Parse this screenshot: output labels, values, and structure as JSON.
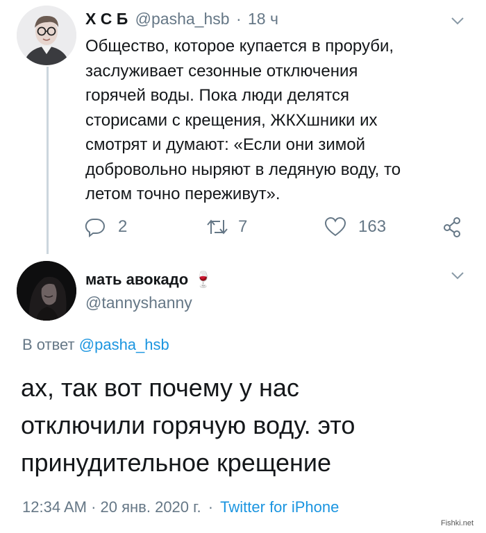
{
  "tweet": {
    "author_name": "Х С Б",
    "handle": "@pasha_hsb",
    "separator": "·",
    "time": "18 ч",
    "text_lines": [
      "Общество, которое купается в проруби,",
      "заслуживает сезонные отключения",
      "горячей воды. Пока люди делятся",
      "сторисами с крещения, ЖКХшники их",
      "смотрят и думают: «Если они зимой",
      "добровольно ныряют в ледяную воду, то",
      "летом точно переживут»."
    ],
    "actions": {
      "replies": "2",
      "retweets": "7",
      "likes": "163"
    }
  },
  "reply": {
    "author_name": "мать авокадо",
    "emoji": "🍷",
    "handle": "@tannyshanny",
    "reply_to_prefix": "В ответ",
    "reply_to_handle": "@pasha_hsb",
    "text_lines": [
      "ах, так вот почему у нас",
      "отключили горячую воду. это",
      "принудительное крещение"
    ],
    "time": "12:34 AM",
    "sep1": "·",
    "date": "20 янв. 2020 г.",
    "sep2": "·",
    "source": "Twitter for iPhone"
  },
  "watermark": "Fishki.net",
  "icons": {
    "reply": "speech-bubble-icon",
    "retweet": "retweet-arrows-icon",
    "like": "heart-icon",
    "share": "share-icon",
    "menu": "chevron-down-icon"
  },
  "colors": {
    "link": "#1b95e0",
    "muted": "#657786",
    "text": "#14171a",
    "line": "#ccd6dd"
  }
}
